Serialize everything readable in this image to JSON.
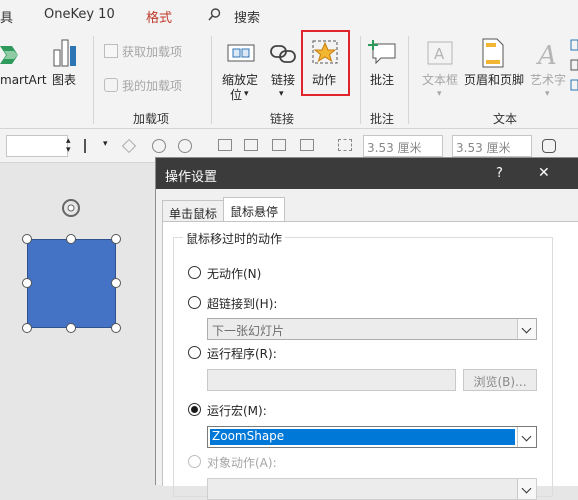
{
  "tabs": {
    "left_partial": "具",
    "onekey": "OneKey 10",
    "format": "格式",
    "search": "搜索"
  },
  "ribbon": {
    "smartart_label": "martArt",
    "chart_label": "图表",
    "get_addins": "获取加载项",
    "my_addins": "我的加载项",
    "addins_group": "加载项",
    "zoom_label_1": "缩放定",
    "zoom_label_2": "位",
    "link_label": "链接",
    "action_label": "动作",
    "links_group": "链接",
    "comment_label": "批注",
    "comment_group": "批注",
    "textbox_label": "文本框",
    "headerfooter_label": "页眉和页脚",
    "wordart_label": "艺术字",
    "text_group": "文本"
  },
  "format_bar": {
    "width1": "3.53 厘米",
    "width2": "3.53 厘米"
  },
  "dialog": {
    "title": "操作设置",
    "help": "?",
    "close": "✕",
    "tab_click": "单击鼠标",
    "tab_hover": "鼠标悬停",
    "section_title": "鼠标移过时的动作",
    "options": {
      "none": "无动作(N)",
      "hyperlink": "超链接到(H):",
      "hyperlink_value": "下一张幻灯片",
      "run_program": "运行程序(R):",
      "run_program_value": "",
      "browse": "浏览(B)...",
      "run_macro": "运行宏(M):",
      "macro_value": "ZoomShape",
      "object_action": "对象动作(A):"
    },
    "selected": "run_macro"
  },
  "colors": {
    "accent": "#2e75b6",
    "highlight_box": "#e0242b",
    "shape_fill": "#4472c4",
    "ribbon_bg": "#f3f3f3",
    "dialog_title_bg": "#3b3b3b",
    "selection": "#0078d7"
  }
}
